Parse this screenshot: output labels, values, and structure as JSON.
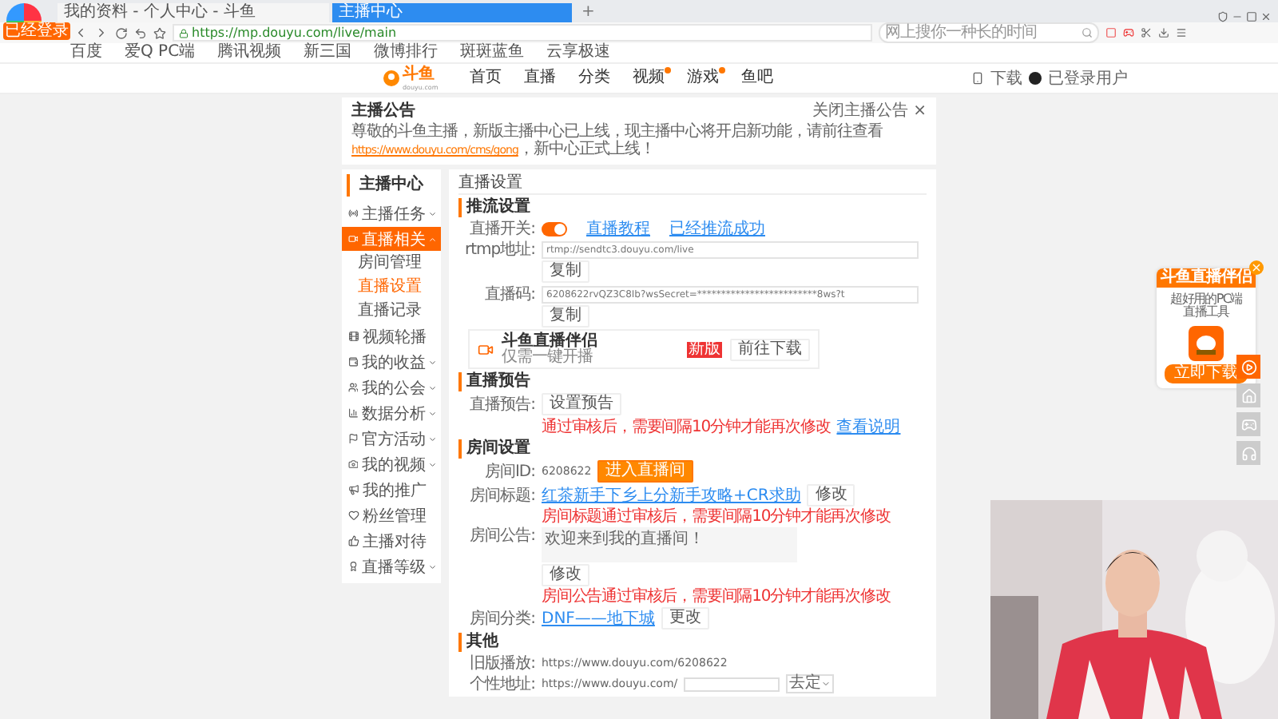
{
  "browser": {
    "badge": "已经登录",
    "tabs": [
      {
        "label": "我的资料 - 个人中心 - 斗鱼",
        "selected": false
      },
      {
        "label": "主播中心",
        "selected": true
      }
    ],
    "new_tab": "+",
    "address": "https://mp.douyu.com/live/main",
    "search_placeholder": "网上搜你一种长的时间",
    "bookmarks": [
      "百度",
      "爱Q PC端",
      "腾讯视频",
      "新三国",
      "微博排行",
      "斑斑蓝鱼",
      "云享极速"
    ]
  },
  "site_nav": {
    "logo": "斗鱼",
    "logo_sub": "douyu.com",
    "items": [
      {
        "label": "首页",
        "dot": false
      },
      {
        "label": "直播",
        "dot": false
      },
      {
        "label": "分类",
        "dot": false
      },
      {
        "label": "视频",
        "dot": true
      },
      {
        "label": "游戏",
        "dot": true
      },
      {
        "label": "鱼吧",
        "dot": false
      }
    ],
    "download": "下载",
    "user": "已登录用户"
  },
  "notice": {
    "title": "主播公告",
    "close_label": "关闭主播公告",
    "close": "×",
    "text_before": "尊敬的斗鱼主播，新版主播中心已上线，现主播中心将开启新功能，请前往查看",
    "link": "https://www.douyu.com/cms/gong",
    "text_after": "，新中心正式上线！"
  },
  "sidebar": {
    "title": "主播中心",
    "items": [
      {
        "label": "主播任务",
        "expandable": true,
        "expanded": false,
        "selected": false
      },
      {
        "label": "直播相关",
        "expandable": true,
        "expanded": true,
        "selected": true,
        "children": [
          {
            "label": "房间管理",
            "selected": false
          },
          {
            "label": "直播设置",
            "selected": true
          },
          {
            "label": "直播记录",
            "selected": false
          }
        ]
      },
      {
        "label": "视频轮播",
        "expandable": false,
        "selected": false
      },
      {
        "label": "我的收益",
        "expandable": true,
        "expanded": false,
        "selected": false
      },
      {
        "label": "我的公会",
        "expandable": true,
        "expanded": false,
        "selected": false
      },
      {
        "label": "数据分析",
        "expandable": true,
        "expanded": false,
        "selected": false
      },
      {
        "label": "官方活动",
        "expandable": true,
        "expanded": false,
        "selected": false
      },
      {
        "label": "我的视频",
        "expandable": true,
        "expanded": false,
        "selected": false
      },
      {
        "label": "我的推广",
        "expandable": false,
        "selected": false
      },
      {
        "label": "粉丝管理",
        "expandable": false,
        "selected": false
      },
      {
        "label": "主播对待",
        "expandable": false,
        "selected": false
      },
      {
        "label": "直播等级",
        "expandable": true,
        "expanded": false,
        "selected": false
      }
    ]
  },
  "main": {
    "title": "直播设置",
    "sections": [
      {
        "heading": "推流设置",
        "rows": [
          {
            "kind": "toggle",
            "label": "直播开关:",
            "on": true,
            "links": [
              "直播教程",
              "已经推流成功"
            ]
          },
          {
            "kind": "copy",
            "label": "rtmp地址:",
            "value": "rtmp://sendtc3.douyu.com/live",
            "button": "复制"
          },
          {
            "kind": "copy",
            "label": "直播码:",
            "value": "6208622rvQZ3C8Ib?wsSecret=*************************8ws?t",
            "button": "复制"
          },
          {
            "kind": "promo",
            "title": "斗鱼直播伴侣",
            "tag": "新版",
            "subtitle": "仅需一键开播",
            "button": "前往下载"
          }
        ]
      },
      {
        "heading": "直播预告",
        "rows": [
          {
            "kind": "action",
            "label": "直播预告:",
            "button": "设置预告",
            "note": "通过审核后，需要间隔10分钟才能再次修改",
            "note_link": "查看说明"
          }
        ]
      },
      {
        "heading": "房间设置",
        "rows": [
          {
            "kind": "room_id",
            "label": "房间ID:",
            "value": "6208622",
            "button": "进入直播间"
          },
          {
            "kind": "link_edit",
            "label": "房间标题:",
            "link": "红茶新手下乡上分新手攻略+CR求助",
            "button": "修改",
            "note": "房间标题通过审核后，需要间隔10分钟才能再次修改"
          },
          {
            "kind": "textarea",
            "label": "房间公告:",
            "value": "欢迎来到我的直播间！",
            "button": "修改",
            "note": "房间公告通过审核后，需要间隔10分钟才能再次修改"
          },
          {
            "kind": "link_edit",
            "label": "房间分类:",
            "link": "DNF——地下城",
            "button": "更改"
          }
        ]
      },
      {
        "heading": "其他",
        "rows": [
          {
            "kind": "text",
            "label": "旧版播放:",
            "value": "https://www.douyu.com/6208622"
          },
          {
            "kind": "custom_url",
            "label": "个性地址:",
            "value": "https://www.douyu.com/",
            "select": "去定"
          }
        ]
      }
    ]
  },
  "widget": {
    "title": "斗鱼直播伴侣",
    "subtitle": "超好用的PC端直播工具",
    "button": "立即下载",
    "close": "×"
  }
}
